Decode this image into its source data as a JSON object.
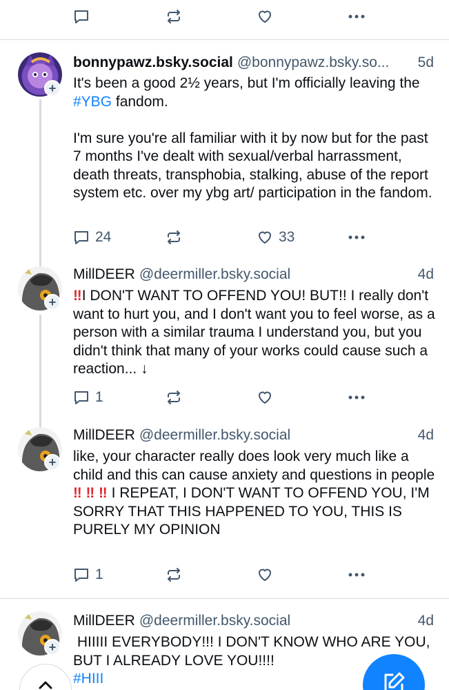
{
  "top_actions": {
    "reply_count": "",
    "like_count": ""
  },
  "posts": [
    {
      "name": "bonnypawz.bsky.social",
      "handle": "@bonnypawz.bsky.so...",
      "time": "5d",
      "text_before_tag": "It's been a good 2½ years, but I'm officially leaving the ",
      "tag": "#YBG",
      "text_after_tag": " fandom.\n\nI'm sure you're all familiar with it by now but for the past 7 months I've dealt with sexual/verbal harrassment, death threats, transphobia, stalking, abuse of the report system etc. over my ybg art/ participation in the fandom.",
      "reply_count": "24",
      "like_count": "33"
    },
    {
      "name": "MillDEER",
      "handle": "@deermiller.bsky.social",
      "time": "4d",
      "bang": "‼",
      "text": "I DON'T WANT TO OFFEND YOU! BUT!! I really don't want to hurt you, and I don't want you to feel worse, as a person with a similar trauma I understand you, but you didn't think that many of your works could cause such a reaction... ↓",
      "reply_count": "1",
      "like_count": ""
    },
    {
      "name": "MillDEER",
      "handle": "@deermiller.bsky.social",
      "time": "4d",
      "text_line1": "like, your character really does look very much like a child and this can cause anxiety and questions in people",
      "bangs": "‼ ‼ ‼",
      "text_line2": " I REPEAT, I DON'T WANT TO OFFEND YOU, I'M SORRY THAT THIS HAPPENED TO YOU, THIS IS PURELY MY OPINION",
      "reply_count": "1",
      "like_count": ""
    },
    {
      "name": "MillDEER",
      "handle": "@deermiller.bsky.social",
      "time": "4d",
      "text": " HIIIII EVERYBODY!!! I DON'T KNOW WHO ARE YOU, BUT I ALREADY LOVE YOU!!!!",
      "tag": "#HIII"
    }
  ],
  "icons": {
    "reply": "speech-bubble-icon",
    "repost": "repost-arrows-icon",
    "like": "heart-icon",
    "more": "ellipsis-icon",
    "follow": "plus-icon",
    "compose": "pencil-icon",
    "scroll_top": "chevron-up-icon"
  },
  "colors": {
    "accent": "#1083fe",
    "muted": "#42576c",
    "divider": "#d4dbe2",
    "warning": "#e0282f"
  }
}
